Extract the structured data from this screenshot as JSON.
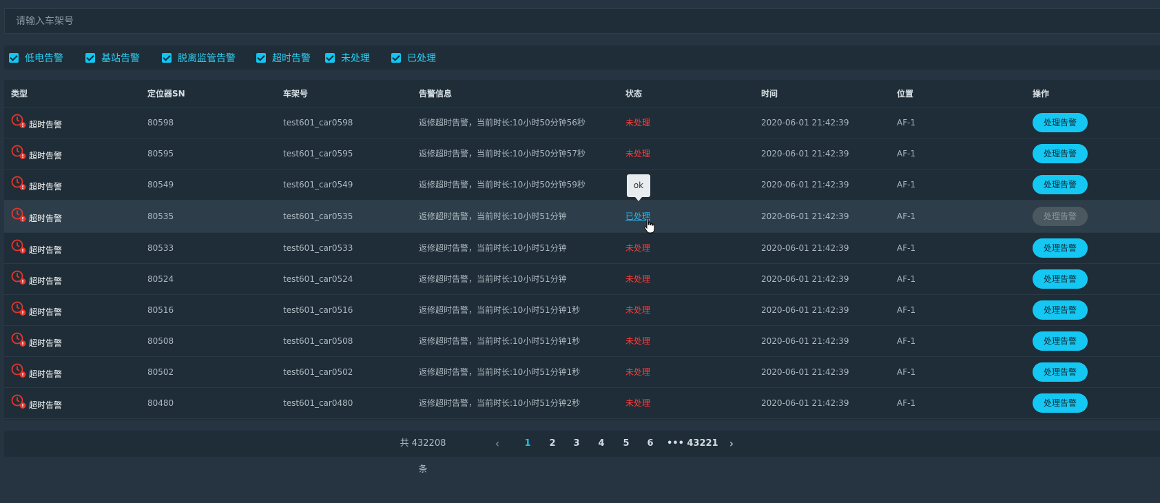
{
  "search": {
    "placeholder": "请输入车架号"
  },
  "filters": [
    {
      "label": "低电告警",
      "checked": true
    },
    {
      "label": "基站告警",
      "checked": true
    },
    {
      "label": "脱离监管告警",
      "checked": true
    },
    {
      "label": "超时告警",
      "checked": true
    },
    {
      "label": "未处理",
      "checked": true
    },
    {
      "label": "已处理",
      "checked": true
    }
  ],
  "table": {
    "headers": [
      "类型",
      "定位器SN",
      "车架号",
      "告警信息",
      "状态",
      "时间",
      "位置",
      "操作"
    ],
    "rows": [
      {
        "type": "超时告警",
        "sn": "80598",
        "vin": "test601_car0598",
        "info": "返修超时告警，当前时长:10小时50分钟56秒",
        "status": "未处理",
        "time": "2020-06-01 21:42:39",
        "location": "AF-1",
        "action": "处理告警"
      },
      {
        "type": "超时告警",
        "sn": "80595",
        "vin": "test601_car0595",
        "info": "返修超时告警，当前时长:10小时50分钟57秒",
        "status": "未处理",
        "time": "2020-06-01 21:42:39",
        "location": "AF-1",
        "action": "处理告警"
      },
      {
        "type": "超时告警",
        "sn": "80549",
        "vin": "test601_car0549",
        "info": "返修超时告警，当前时长:10小时50分钟59秒",
        "status": "",
        "time": "2020-06-01 21:42:39",
        "location": "AF-1",
        "action": "处理告警"
      },
      {
        "type": "超时告警",
        "sn": "80535",
        "vin": "test601_car0535",
        "info": "返修超时告警，当前时长:10小时51分钟",
        "status": "已处理",
        "time": "2020-06-01 21:42:39",
        "location": "AF-1",
        "action": "处理告警"
      },
      {
        "type": "超时告警",
        "sn": "80533",
        "vin": "test601_car0533",
        "info": "返修超时告警，当前时长:10小时51分钟",
        "status": "未处理",
        "time": "2020-06-01 21:42:39",
        "location": "AF-1",
        "action": "处理告警"
      },
      {
        "type": "超时告警",
        "sn": "80524",
        "vin": "test601_car0524",
        "info": "返修超时告警，当前时长:10小时51分钟",
        "status": "未处理",
        "time": "2020-06-01 21:42:39",
        "location": "AF-1",
        "action": "处理告警"
      },
      {
        "type": "超时告警",
        "sn": "80516",
        "vin": "test601_car0516",
        "info": "返修超时告警，当前时长:10小时51分钟1秒",
        "status": "未处理",
        "time": "2020-06-01 21:42:39",
        "location": "AF-1",
        "action": "处理告警"
      },
      {
        "type": "超时告警",
        "sn": "80508",
        "vin": "test601_car0508",
        "info": "返修超时告警，当前时长:10小时51分钟1秒",
        "status": "未处理",
        "time": "2020-06-01 21:42:39",
        "location": "AF-1",
        "action": "处理告警"
      },
      {
        "type": "超时告警",
        "sn": "80502",
        "vin": "test601_car0502",
        "info": "返修超时告警，当前时长:10小时51分钟1秒",
        "status": "未处理",
        "time": "2020-06-01 21:42:39",
        "location": "AF-1",
        "action": "处理告警"
      },
      {
        "type": "超时告警",
        "sn": "80480",
        "vin": "test601_car0480",
        "info": "返修超时告警，当前时长:10小时51分钟2秒",
        "status": "未处理",
        "time": "2020-06-01 21:42:39",
        "location": "AF-1",
        "action": "处理告警"
      }
    ]
  },
  "tooltip": {
    "text": "ok"
  },
  "pagination": {
    "total": "共 432208 条",
    "pages": [
      "1",
      "2",
      "3",
      "4",
      "5",
      "6",
      "•••",
      "43221"
    ],
    "prev": "‹",
    "next": "›"
  },
  "colors": {
    "accent": "#14c8f3",
    "unprocessed": "#ff3b3b",
    "processed": "#2bb8f5",
    "background": "#253440",
    "panel": "#1e2d37"
  }
}
